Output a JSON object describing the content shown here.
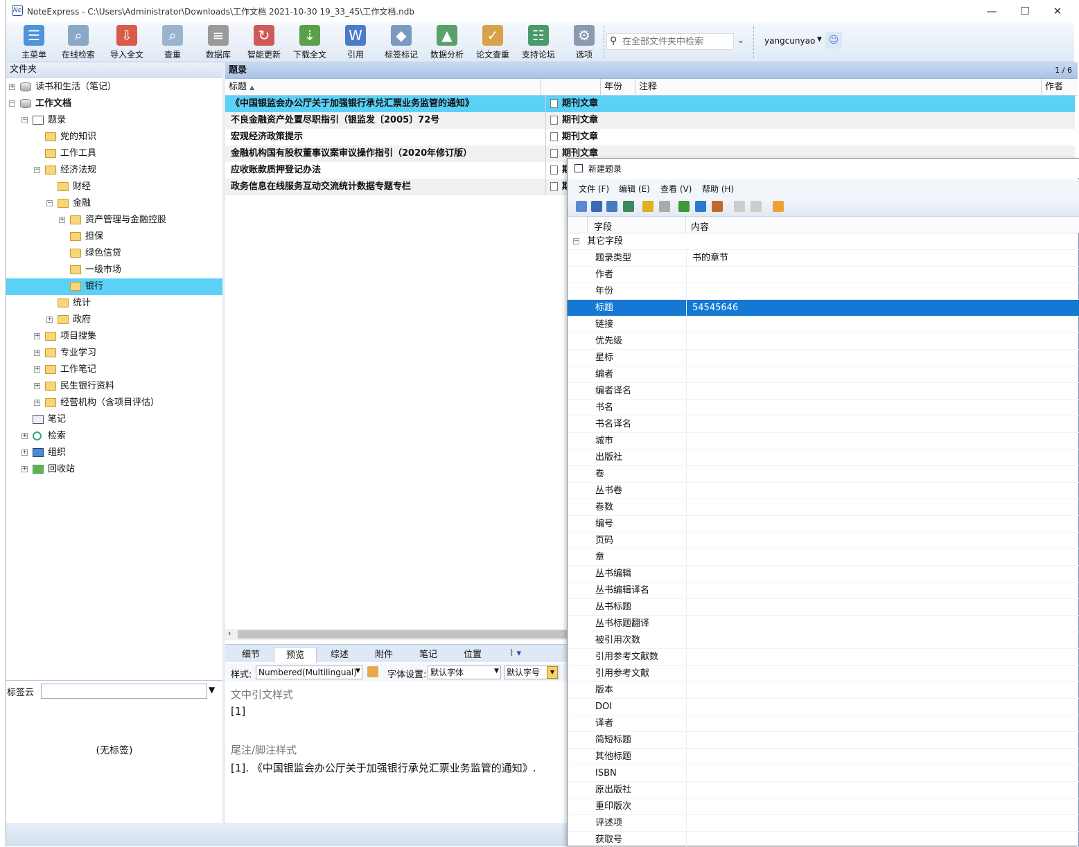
{
  "window": {
    "app_name": "NoteExpress",
    "title": "NoteExpress - C:\\Users\\Administrator\\Downloads\\工作文档 2021-10-30 19_33_45\\工作文档.ndb",
    "minimize": "—",
    "maximize": "☐",
    "close": "✕"
  },
  "toolbar": {
    "buttons": [
      {
        "label": "主菜单",
        "icon": "main-menu-icon",
        "color": "#4f93d8"
      },
      {
        "label": "在线检索",
        "icon": "online-search-icon",
        "color": "#8aa8c8"
      },
      {
        "label": "导入全文",
        "icon": "import-fulltext-icon",
        "color": "#d85a4a"
      },
      {
        "label": "查重",
        "icon": "duplicate-check-icon",
        "color": "#9ab4d0"
      },
      {
        "label": "数据库",
        "icon": "database-icon",
        "color": "#9a9a9a"
      },
      {
        "label": "智能更新",
        "icon": "smart-update-icon",
        "color": "#d05a5a"
      },
      {
        "label": "下载全文",
        "icon": "download-fulltext-icon",
        "color": "#5aa04a"
      },
      {
        "label": "引用",
        "icon": "cite-icon",
        "color": "#4a7ac8"
      },
      {
        "label": "标签标记",
        "icon": "tag-icon",
        "color": "#7a9ac0"
      },
      {
        "label": "数据分析",
        "icon": "data-analysis-icon",
        "color": "#5aa06a"
      },
      {
        "label": "论文查重",
        "icon": "paper-check-icon",
        "color": "#d8a24a"
      },
      {
        "label": "支持论坛",
        "icon": "forum-icon",
        "color": "#4a9a6a"
      },
      {
        "label": "选项",
        "icon": "options-icon",
        "color": "#8a9ab0"
      }
    ],
    "search_placeholder": "在全部文件夹中检索",
    "user": "yangcunyao"
  },
  "left": {
    "header": "文件夹",
    "tree": [
      {
        "label": "读书和生活（笔记）",
        "level": 0,
        "exp": "+",
        "icon": "db"
      },
      {
        "label": "工作文档",
        "level": 0,
        "exp": "-",
        "icon": "db",
        "bold": true
      },
      {
        "label": "题录",
        "level": 1,
        "exp": "-",
        "icon": "list"
      },
      {
        "label": "党的知识",
        "level": 2,
        "exp": "",
        "icon": "folder"
      },
      {
        "label": "工作工具",
        "level": 2,
        "exp": "",
        "icon": "folder"
      },
      {
        "label": "经济法规",
        "level": 2,
        "exp": "-",
        "icon": "folder"
      },
      {
        "label": "财经",
        "level": 3,
        "exp": "",
        "icon": "folder"
      },
      {
        "label": "金融",
        "level": 3,
        "exp": "-",
        "icon": "folder"
      },
      {
        "label": "资产管理与金融控股",
        "level": 4,
        "exp": "+",
        "icon": "folder"
      },
      {
        "label": "担保",
        "level": 4,
        "exp": "",
        "icon": "folder"
      },
      {
        "label": "绿色信贷",
        "level": 4,
        "exp": "",
        "icon": "folder"
      },
      {
        "label": "一级市场",
        "level": 4,
        "exp": "",
        "icon": "folder"
      },
      {
        "label": "银行",
        "level": 4,
        "exp": "",
        "icon": "folder",
        "selected": true
      },
      {
        "label": "统计",
        "level": 3,
        "exp": "",
        "icon": "folder"
      },
      {
        "label": "政府",
        "level": 3,
        "exp": "+",
        "icon": "folder"
      },
      {
        "label": "项目搜集",
        "level": 2,
        "exp": "+",
        "icon": "folder"
      },
      {
        "label": "专业学习",
        "level": 2,
        "exp": "+",
        "icon": "folder"
      },
      {
        "label": "工作笔记",
        "level": 2,
        "exp": "+",
        "icon": "folder"
      },
      {
        "label": "民生银行资料",
        "level": 2,
        "exp": "+",
        "icon": "folder"
      },
      {
        "label": "经营机构（含项目评估）",
        "level": 2,
        "exp": "+",
        "icon": "folder"
      },
      {
        "label": "笔记",
        "level": 1,
        "exp": "",
        "icon": "note"
      },
      {
        "label": "检索",
        "level": 1,
        "exp": "+",
        "icon": "search"
      },
      {
        "label": "组织",
        "level": 1,
        "exp": "+",
        "icon": "org"
      },
      {
        "label": "回收站",
        "level": 1,
        "exp": "+",
        "icon": "trash"
      }
    ],
    "tag_label": "标签云",
    "tag_empty": "(无标签)"
  },
  "main": {
    "header": "题录",
    "count": "1 / 6",
    "columns": {
      "title": "标题",
      "sort": "▲",
      "year": "年份",
      "notes": "注释",
      "author": "作者"
    },
    "rows": [
      {
        "title": "《中国银监会办公厅关于加强银行承兑汇票业务监管的通知》",
        "type": "期刊文章",
        "highlight": true
      },
      {
        "title": "不良金融资产处置尽职指引（银监发〔2005〕72号",
        "type": "期刊文章"
      },
      {
        "title": "宏观经济政策提示",
        "type": "期刊文章"
      },
      {
        "title": "金融机构国有股权董事议案审议操作指引（2020年修订版）",
        "type": "期刊文章"
      },
      {
        "title": "应收账款质押登记办法",
        "type": "期"
      },
      {
        "title": "政务信息在线服务互动交流统计数据专题专栏",
        "type": "期"
      }
    ],
    "tabs": [
      "细节",
      "预览",
      "综述",
      "附件",
      "笔记",
      "位置"
    ],
    "active_tab": "预览",
    "style_label": "样式:",
    "style_value": "Numbered(Multilingual)",
    "font_label": "字体设置:",
    "font_value": "默认字体",
    "size_value": "默认字号",
    "preview": {
      "inline_heading": "文中引文样式",
      "inline_text": "[1]",
      "foot_heading": "尾注/脚注样式",
      "foot_text": "[1].    《中国银监会办公厅关于加强银行承兑汇票业务监管的通知》."
    }
  },
  "dialog": {
    "title": "新建题录",
    "menu": [
      "文件 (F)",
      "编辑 (E)",
      "查看 (V)",
      "帮助 (H)"
    ],
    "col_field": "字段",
    "col_content": "内容",
    "group": "其它字段",
    "fields": [
      {
        "f": "题录类型",
        "v": "书的章节"
      },
      {
        "f": "作者",
        "v": ""
      },
      {
        "f": "年份",
        "v": ""
      },
      {
        "f": "标题",
        "v": "54545646",
        "selected": true
      },
      {
        "f": "链接",
        "v": ""
      },
      {
        "f": "优先级",
        "v": ""
      },
      {
        "f": "星标",
        "v": ""
      },
      {
        "f": "编者",
        "v": ""
      },
      {
        "f": "编者译名",
        "v": ""
      },
      {
        "f": "书名",
        "v": ""
      },
      {
        "f": "书名译名",
        "v": ""
      },
      {
        "f": "城市",
        "v": ""
      },
      {
        "f": "出版社",
        "v": ""
      },
      {
        "f": "卷",
        "v": ""
      },
      {
        "f": "丛书卷",
        "v": ""
      },
      {
        "f": "卷数",
        "v": ""
      },
      {
        "f": "编号",
        "v": ""
      },
      {
        "f": "页码",
        "v": ""
      },
      {
        "f": "章",
        "v": ""
      },
      {
        "f": "丛书编辑",
        "v": ""
      },
      {
        "f": "丛书编辑译名",
        "v": ""
      },
      {
        "f": "丛书标题",
        "v": ""
      },
      {
        "f": "丛书标题翻译",
        "v": ""
      },
      {
        "f": "被引用次数",
        "v": ""
      },
      {
        "f": "引用参考文献数",
        "v": ""
      },
      {
        "f": "引用参考文献",
        "v": ""
      },
      {
        "f": "版本",
        "v": ""
      },
      {
        "f": "DOI",
        "v": ""
      },
      {
        "f": "译者",
        "v": ""
      },
      {
        "f": "简短标题",
        "v": ""
      },
      {
        "f": "其他标题",
        "v": ""
      },
      {
        "f": "ISBN",
        "v": ""
      },
      {
        "f": "原出版社",
        "v": ""
      },
      {
        "f": "重印版次",
        "v": ""
      },
      {
        "f": "评述项",
        "v": ""
      },
      {
        "f": "获取号",
        "v": ""
      }
    ]
  }
}
